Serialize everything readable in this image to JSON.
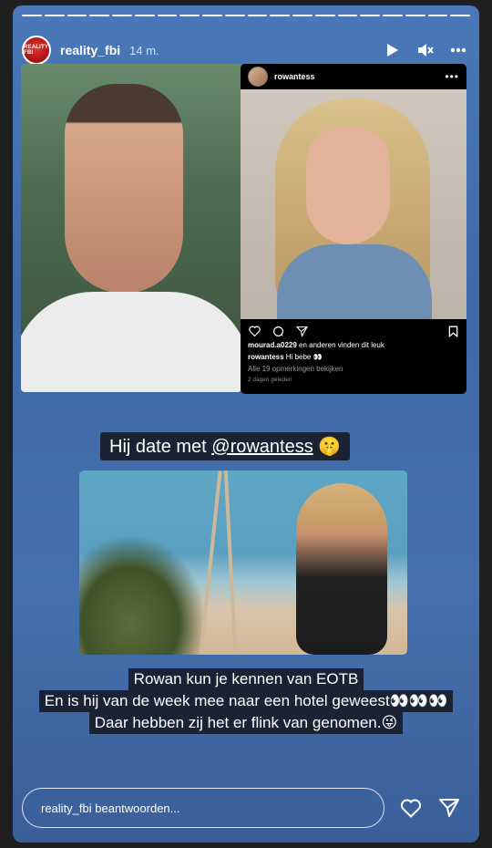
{
  "header": {
    "username": "reality_fbi",
    "time": "14 m.",
    "avatar_text": "REALITY FBI",
    "icons": [
      "play-icon",
      "mute-icon",
      "more-icon"
    ]
  },
  "progress_segments": 20,
  "repost": {
    "username": "rowantess",
    "likes_user": "mourad.a0229",
    "likes_suffix": " en anderen vinden dit leuk",
    "caption_user": "rowantess",
    "caption_text": " Hi bebe 👀",
    "comments_link": "Alle 19 opmerkingen bekijken",
    "timestamp": "2 dagen geleden",
    "icons": [
      "heart-icon",
      "comment-icon",
      "share-icon",
      "bookmark-icon"
    ]
  },
  "caption1": {
    "prefix": "Hij date met ",
    "mention": "@rowantess",
    "emoji": " 🤫"
  },
  "caption2": {
    "lines": [
      "Rowan kun je kennen van EOTB",
      "En is hij van de week mee naar een hotel geweest👀👀👀",
      "Daar hebben zij het er flink van genomen.😜"
    ]
  },
  "reply": {
    "placeholder": "reality_fbi beantwoorden..."
  },
  "colors": {
    "background": "#4570ad",
    "caption_bg": "#1a2234"
  }
}
